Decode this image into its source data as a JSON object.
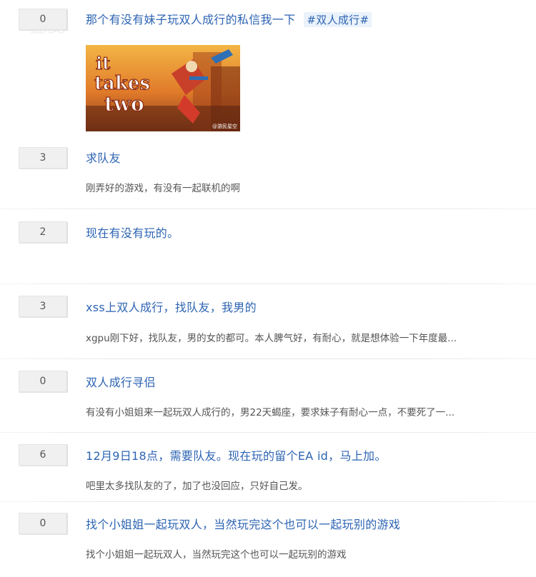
{
  "watermark": {
    "text": "游民"
  },
  "posts": [
    {
      "reply_count": "0",
      "title": "那个有没有妹子玩双人成行的私信我一下",
      "tag": "#双人成行#",
      "abstract": "",
      "thumbnail": {
        "logo_lines": [
          "it",
          "takes",
          "two"
        ],
        "caption": "@游民星空"
      }
    },
    {
      "reply_count": "3",
      "title": "求队友",
      "abstract": "刚弄好的游戏，有没有一起联机的啊"
    },
    {
      "reply_count": "2",
      "title": "现在有没有玩的。",
      "abstract": ""
    },
    {
      "reply_count": "3",
      "title": "xss上双人成行，找队友，我男的",
      "abstract": "xgpu刚下好，找队友，男的女的都可。本人脾气好，有耐心，就是想体验一下年度最..."
    },
    {
      "reply_count": "0",
      "title": "双人成行寻侣",
      "abstract": "有没有小姐姐来一起玩双人成行的，男22天蝎座，要求妹子有耐心一点，不要死了一..."
    },
    {
      "reply_count": "6",
      "title": "12月9日18点，需要队友。现在玩的留个EA id，马上加。",
      "abstract": "吧里太多找队友的了，加了也没回应，只好自己发。"
    },
    {
      "reply_count": "0",
      "title": "找个小姐姐一起玩双人，当然玩完这个也可以一起玩别的游戏",
      "abstract": "找个小姐姐一起玩双人，当然玩完这个也可以一起玩别的游戏"
    }
  ]
}
